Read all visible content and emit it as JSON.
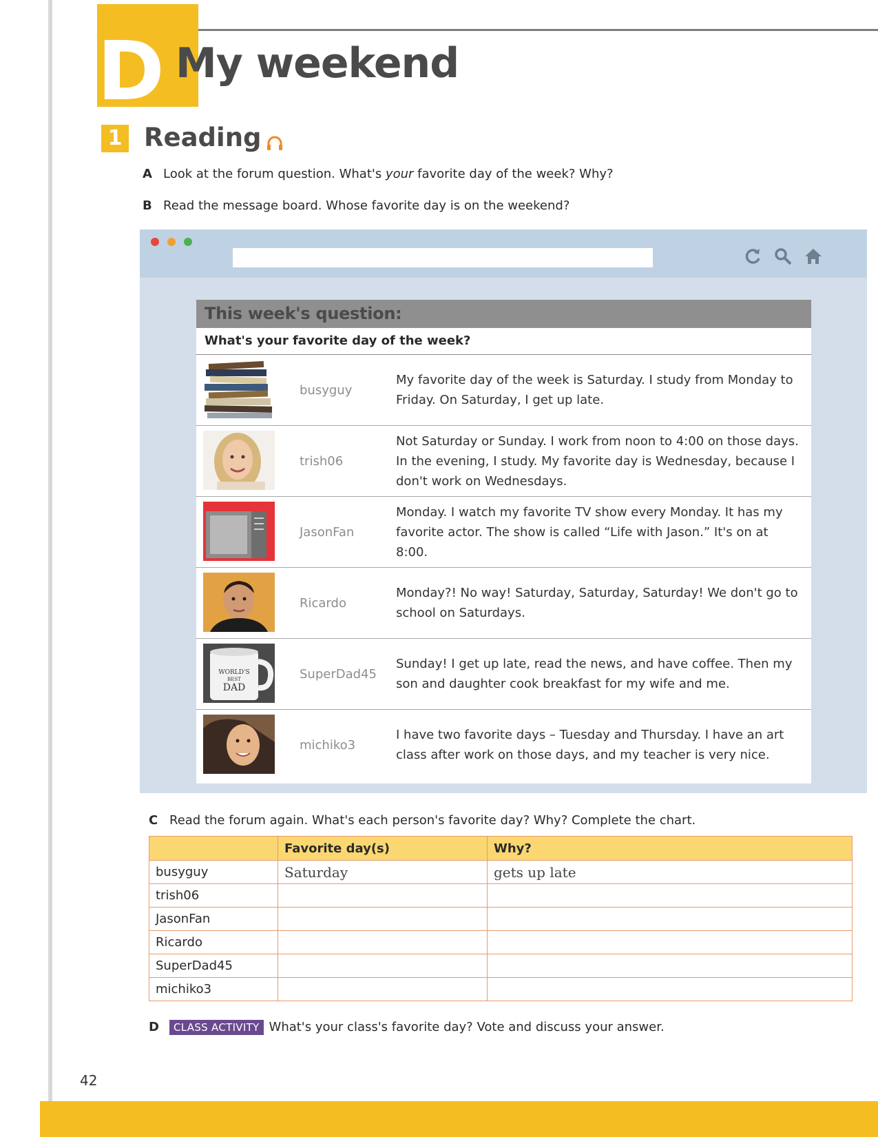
{
  "unit": {
    "letter": "D",
    "title": "My weekend"
  },
  "section": {
    "number": "1",
    "title": "Reading"
  },
  "instructions": {
    "a_letter": "A",
    "a_text_1": "Look at the forum question. What's ",
    "a_text_em": "your",
    "a_text_2": " favorite day of the week? Why?",
    "b_letter": "B",
    "b_text": "Read the message board. Whose favorite day is on the weekend?",
    "c_letter": "C",
    "c_text": "Read the forum again. What's each person's favorite day? Why? Complete the chart.",
    "d_letter": "D",
    "d_tag": "CLASS ACTIVITY",
    "d_text": "What's your class's favorite day? Vote and discuss your answer."
  },
  "browser": {
    "dot_colors": [
      "#e8453c",
      "#f0a030",
      "#4caf50"
    ],
    "icons": [
      "refresh-icon",
      "search-icon",
      "home-icon"
    ],
    "address_value": ""
  },
  "forum": {
    "heading": "This week's question:",
    "question": "What's your favorite day of the week?",
    "posts": [
      {
        "user": "busyguy",
        "avatar": "stack-of-books-image",
        "message": "My favorite day of the week is Saturday. I study from Monday to Friday. On Saturday, I get up late."
      },
      {
        "user": "trish06",
        "avatar": "smiling-woman-image",
        "message": "Not Saturday or Sunday. I work from noon to 4:00 on those days. In the evening, I study. My favorite day is Wednesday, because I don't work on Wednesdays."
      },
      {
        "user": "JasonFan",
        "avatar": "television-image",
        "message": "Monday. I watch my favorite TV show every Monday. It has my favorite actor. The show is called “Life with Jason.” It's on at 8:00."
      },
      {
        "user": "Ricardo",
        "avatar": "young-man-image",
        "message": "Monday?! No way! Saturday, Saturday, Saturday! We don't go to school on Saturdays."
      },
      {
        "user": "SuperDad45",
        "avatar": "worlds-best-dad-mug-image",
        "message": "Sunday! I get up late, read the news, and have coffee. Then my son and daughter cook breakfast for my wife and me."
      },
      {
        "user": "michiko3",
        "avatar": "smiling-woman-hair-image",
        "message": "I have two favorite days – Tuesday and Thursday. I have an art class after work on those days, and my teacher is very nice."
      }
    ],
    "mug_text": [
      "WORLD'S",
      "BEST",
      "DAD"
    ]
  },
  "chart": {
    "headers": [
      "",
      "Favorite day(s)",
      "Why?"
    ],
    "rows": [
      [
        "busyguy",
        "Saturday",
        "gets up late"
      ],
      [
        "trish06",
        "",
        ""
      ],
      [
        "JasonFan",
        "",
        ""
      ],
      [
        "Ricardo",
        "",
        ""
      ],
      [
        "SuperDad45",
        "",
        ""
      ],
      [
        "michiko3",
        "",
        ""
      ]
    ]
  },
  "page_number": "42",
  "colors": {
    "accent_yellow": "#f4bd22",
    "chart_border": "#e79a6c",
    "chart_header": "#fbd772",
    "tag_purple": "#6a4a8f"
  }
}
